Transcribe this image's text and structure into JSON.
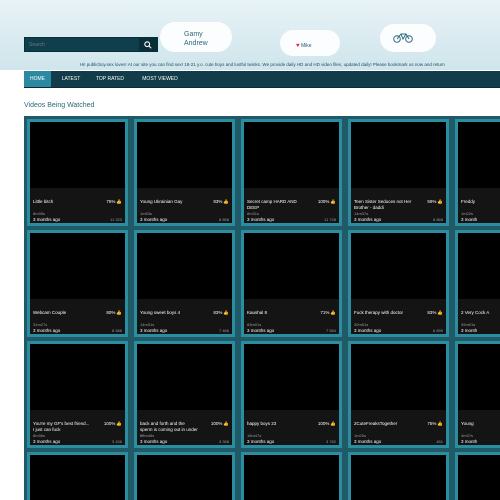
{
  "header": {
    "search_placeholder": "Search",
    "logo_lines": [
      "Gamy",
      "Andrew"
    ],
    "heart_text": "Mike",
    "tagline": "Hi! publicboy.sex loves! At our site you can find sex! 18-21 y.o. cute boys and lustful twinks. We provide daily HD and HD video files, updated daily! Please bookmark us now and return"
  },
  "nav": {
    "items": [
      {
        "label": "HOME",
        "active": true
      },
      {
        "label": "LATEST",
        "active": false
      },
      {
        "label": "TOP RATED",
        "active": false
      },
      {
        "label": "MOST VIEWED",
        "active": false
      }
    ]
  },
  "section": {
    "title": "Videos Being Watched"
  },
  "videos": [
    {
      "title": "Little bitch",
      "percent": "75%",
      "duration": "8m35s",
      "age": "3 months ago",
      "views": "11 323"
    },
    {
      "title": "Young Ukrainian Gay",
      "percent": "83%",
      "duration": "1m53s",
      "age": "3 months ago",
      "views": "8 858"
    },
    {
      "title": "Secret camp HARD AND DEEP",
      "percent": "100%",
      "duration": "8m31s",
      "age": "3 months ago",
      "views": "11 728"
    },
    {
      "title": "Teen Sister Seduces not Her Brother - daddi",
      "percent": "59%",
      "duration": "14m37s",
      "age": "3 months ago",
      "views": "8 868"
    },
    {
      "title": "Freddy",
      "percent": "",
      "duration": "1m22s",
      "age": "3 month",
      "views": ""
    },
    {
      "title": "Webcam Couple",
      "percent": "80%",
      "duration": "31m27s",
      "age": "3 months ago",
      "views": "8 588"
    },
    {
      "title": "Young sweet boys 4",
      "percent": "83%",
      "duration": "14m31s",
      "age": "3 months ago",
      "views": "7 466"
    },
    {
      "title": "Kaushal 8",
      "percent": "71%",
      "duration": "83m01s",
      "age": "3 months ago",
      "views": "7 584"
    },
    {
      "title": "Fuck therapy with doctor",
      "percent": "83%",
      "duration": "30m51s",
      "age": "3 months ago",
      "views": "6 899"
    },
    {
      "title": "2 Very Cock A",
      "percent": "",
      "duration": "39m01s",
      "age": "3 month",
      "views": ""
    },
    {
      "title": "You're my GF's best friend... I just can fuck",
      "percent": "100%",
      "duration": "8m36s",
      "age": "3 months ago",
      "views": "3 156"
    },
    {
      "title": "back and forth and the sperm is coming out in under ...",
      "percent": "100%",
      "duration": "58m48s",
      "age": "3 months ago",
      "views": "3 358"
    },
    {
      "title": "happy boys 23",
      "percent": "100%",
      "duration": "18m47s",
      "age": "3 months ago",
      "views": "3 782"
    },
    {
      "title": "2CuteFreaksTogether",
      "percent": "75%",
      "duration": "1m20s",
      "age": "3 months ago",
      "views": "451"
    },
    {
      "title": "Young",
      "percent": "",
      "duration": "4m37s",
      "age": "3 month",
      "views": ""
    },
    {
      "title": "",
      "percent": "",
      "duration": "",
      "age": "",
      "views": ""
    },
    {
      "title": "",
      "percent": "",
      "duration": "",
      "age": "",
      "views": ""
    },
    {
      "title": "",
      "percent": "",
      "duration": "",
      "age": "",
      "views": ""
    },
    {
      "title": "",
      "percent": "",
      "duration": "",
      "age": "",
      "views": ""
    },
    {
      "title": "",
      "percent": "",
      "duration": "",
      "age": "",
      "views": ""
    }
  ],
  "colors": {
    "navbar": "#123c49",
    "nav_active": "#2b8aa1",
    "card_border": "#2b8da0",
    "grid_bg": "#1f5a66",
    "title_text": "#2a6a7a"
  }
}
